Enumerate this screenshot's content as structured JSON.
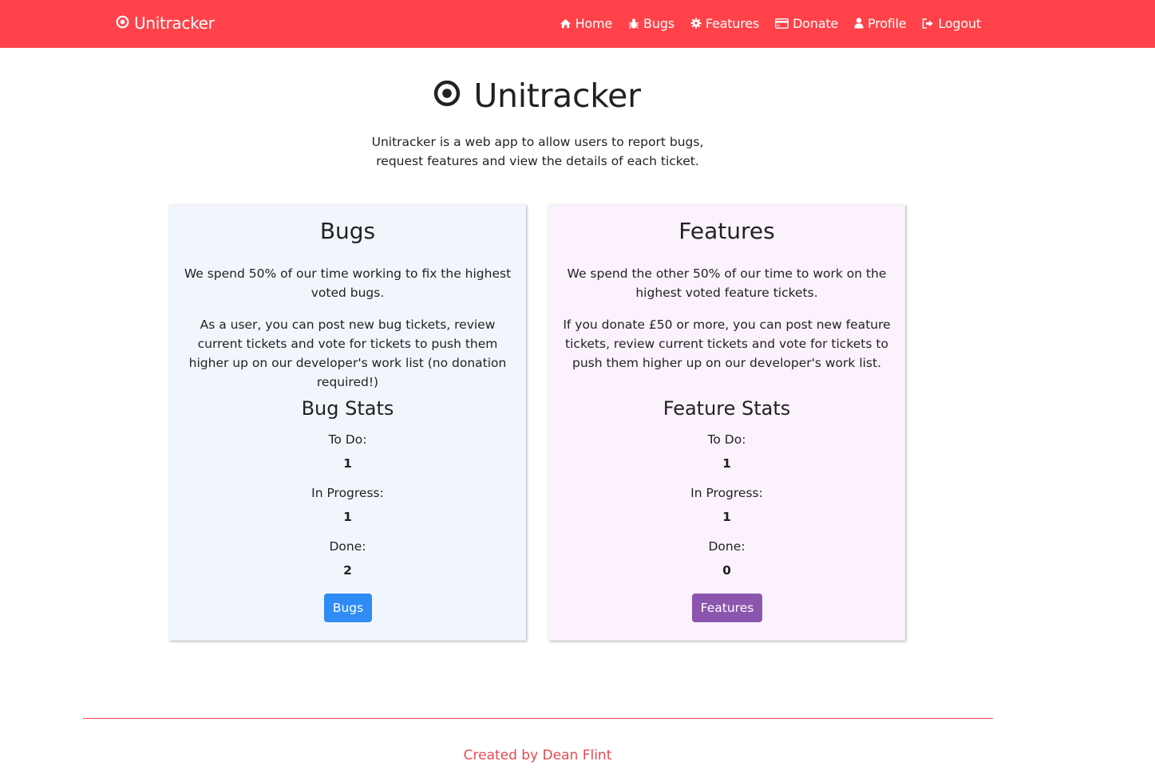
{
  "navbar": {
    "brand": "Unitracker",
    "links": [
      {
        "label": "Home",
        "icon": "home-icon"
      },
      {
        "label": "Bugs",
        "icon": "bug-icon"
      },
      {
        "label": "Features",
        "icon": "cog-icon"
      },
      {
        "label": "Donate",
        "icon": "credit-card-icon"
      },
      {
        "label": "Profile",
        "icon": "user-icon"
      },
      {
        "label": "Logout",
        "icon": "logout-icon"
      }
    ]
  },
  "hero": {
    "title": "Unitracker",
    "description": "Unitracker is a web app to allow users to report bugs, request features and view the details of each ticket."
  },
  "bugs_card": {
    "title": "Bugs",
    "paragraph1": "We spend 50% of our time working to fix the highest voted bugs.",
    "paragraph2": "As a user, you can post new bug tickets, review current tickets and vote for tickets to push them higher up on our developer's work list (no donation required!)",
    "stats_title": "Bug Stats",
    "todo_label": "To Do:",
    "todo_value": "1",
    "progress_label": "In Progress:",
    "progress_value": "1",
    "done_label": "Done:",
    "done_value": "2",
    "button": "Bugs"
  },
  "features_card": {
    "title": "Features",
    "paragraph1": "We spend the other 50% of our time to work on the highest voted feature tickets.",
    "paragraph2": "If you donate £50 or more, you can post new feature tickets, review current tickets and vote for tickets to push them higher up on our developer's work list.",
    "stats_title": "Feature Stats",
    "todo_label": "To Do:",
    "todo_value": "1",
    "progress_label": "In Progress:",
    "progress_value": "1",
    "done_label": "Done:",
    "done_value": "0",
    "button": "Features"
  },
  "footer": {
    "text": "Created by Dean Flint"
  },
  "colors": {
    "navbar": "#ff4249",
    "bugs_card_bg": "#f1f6fc",
    "features_card_bg": "#fbf2fd",
    "bugs_button": "#2f8cf5",
    "features_button": "#8c56ae",
    "footer_accent": "#e8484e"
  }
}
